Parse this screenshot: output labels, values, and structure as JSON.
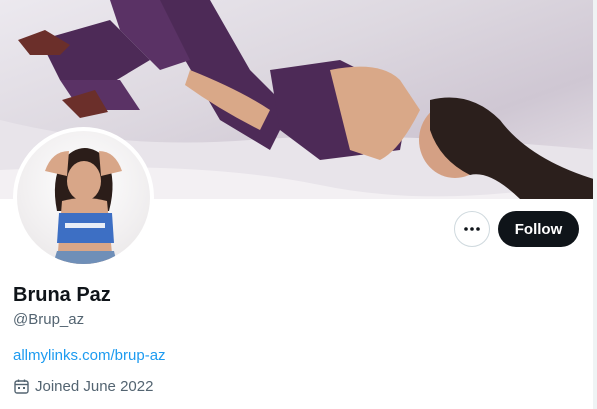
{
  "profile": {
    "display_name": "Bruna Paz",
    "handle": "@Brup_az",
    "link_text": "allmylinks.com/brup-az",
    "joined_text": "Joined June 2022"
  },
  "actions": {
    "follow_label": "Follow",
    "more_label": "More"
  },
  "icons": {
    "more": "more-horizontal-icon",
    "joined": "calendar-icon"
  },
  "colors": {
    "follow_bg": "#0f1419",
    "link": "#1d9bf0",
    "muted": "#536471",
    "outfit": "#4d2a57"
  }
}
